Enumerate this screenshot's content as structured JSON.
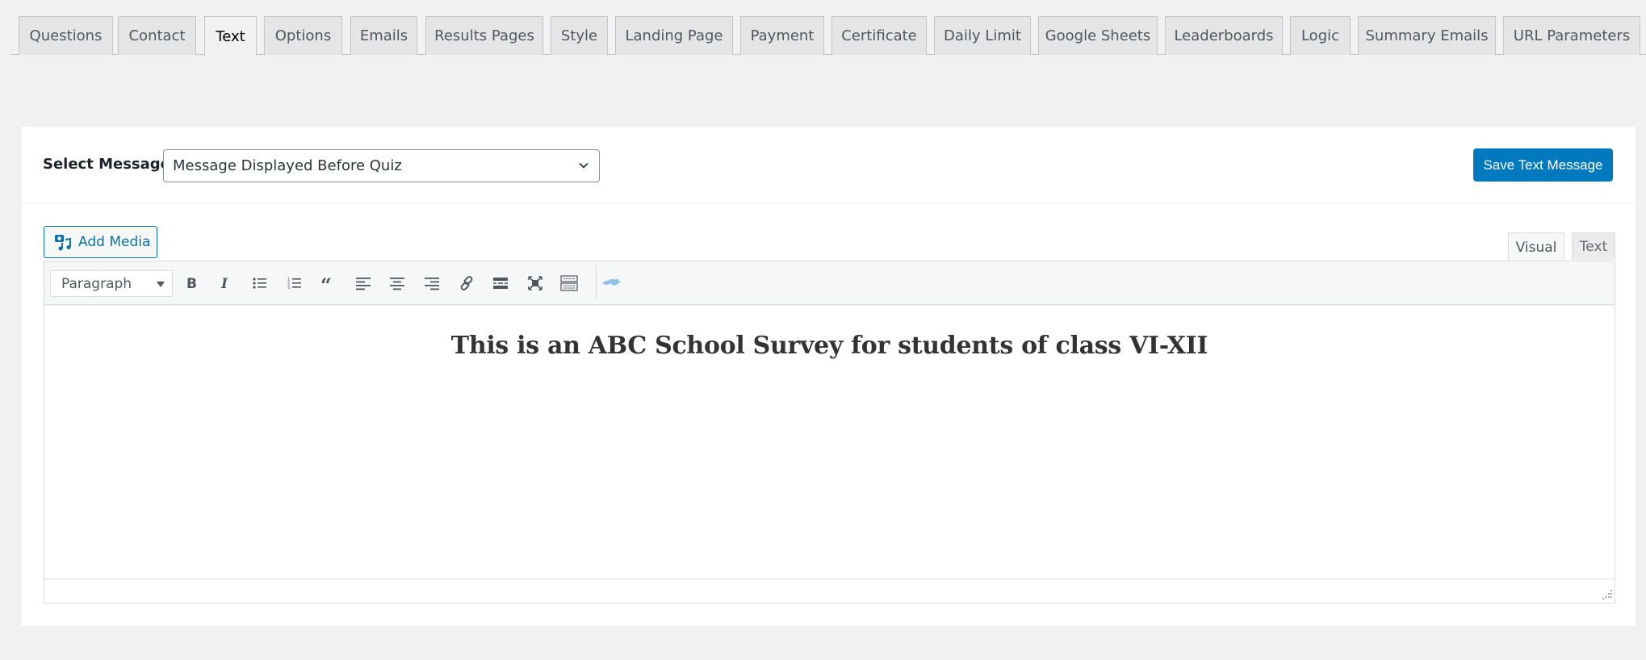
{
  "tabs": [
    {
      "label": "Questions",
      "active": false
    },
    {
      "label": "Contact",
      "active": false
    },
    {
      "label": "Text",
      "active": true
    },
    {
      "label": "Options",
      "active": false
    },
    {
      "label": "Emails",
      "active": false
    },
    {
      "label": "Results Pages",
      "active": false
    },
    {
      "label": "Style",
      "active": false
    },
    {
      "label": "Landing Page",
      "active": false
    },
    {
      "label": "Payment",
      "active": false
    },
    {
      "label": "Certificate",
      "active": false
    },
    {
      "label": "Daily Limit",
      "active": false
    },
    {
      "label": "Google Sheets",
      "active": false
    },
    {
      "label": "Leaderboards",
      "active": false
    },
    {
      "label": "Logic",
      "active": false
    },
    {
      "label": "Summary Emails",
      "active": false
    },
    {
      "label": "URL Parameters",
      "active": false
    }
  ],
  "message_selector": {
    "label": "Select Message",
    "selected": "Message Displayed Before Quiz"
  },
  "save_button": "Save Text Message",
  "editor": {
    "add_media": "Add Media",
    "modes": {
      "visual": "Visual",
      "text": "Text",
      "active": "visual"
    },
    "format_select": "Paragraph",
    "toolbar_icons": [
      "bold-icon",
      "italic-icon",
      "bullet-list-icon",
      "numbered-list-icon",
      "blockquote-icon",
      "align-left-icon",
      "align-center-icon",
      "align-right-icon",
      "link-icon",
      "read-more-icon",
      "fullscreen-icon",
      "toolbar-toggle-icon",
      "twitter-bird-icon"
    ],
    "content_heading": "This is an ABC School Survey for students of class VI-XII"
  },
  "colors": {
    "accent": "#0079be",
    "page_bg": "#f1f1f1"
  }
}
